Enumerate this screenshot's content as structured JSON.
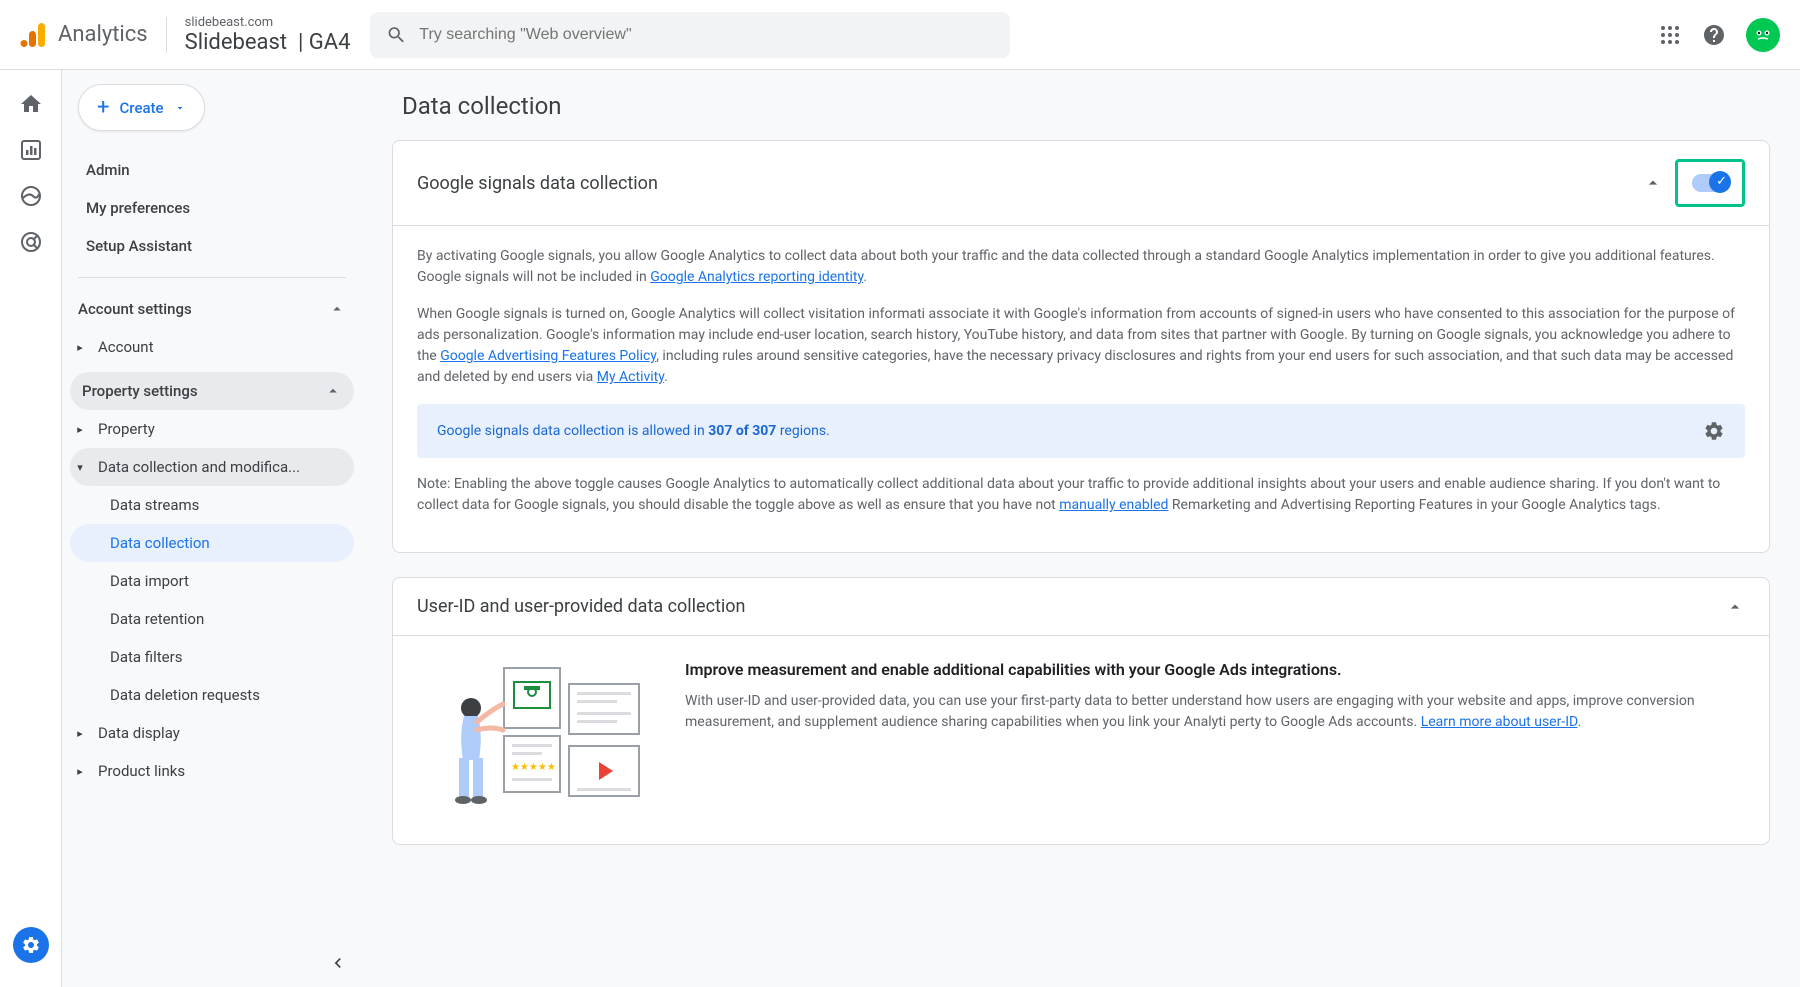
{
  "header": {
    "product_name": "Analytics",
    "domain": "slidebeast.com",
    "property": "Slidebeast",
    "property_suffix": "| GA4",
    "search_placeholder": "Try searching \"Web overview\""
  },
  "sidebar": {
    "create_label": "Create",
    "top_links": [
      "Admin",
      "My preferences",
      "Setup Assistant"
    ],
    "account_settings_label": "Account settings",
    "account_label": "Account",
    "property_settings_label": "Property settings",
    "property_label": "Property",
    "data_collection_group": "Data collection and modifica...",
    "data_items": [
      "Data streams",
      "Data collection",
      "Data import",
      "Data retention",
      "Data filters",
      "Data deletion requests"
    ],
    "data_display_label": "Data display",
    "product_links_label": "Product links"
  },
  "main": {
    "page_title": "Data collection",
    "card1": {
      "title": "Google signals data collection",
      "para1_a": "By activating Google signals, you allow Google Analytics to collect data about both your traffic and the data collected through a standard Google Analytics implementation in order to give you additional features. Google signals will not be included in ",
      "link1": "Google Analytics reporting identity",
      "para2_a": "When Google signals is turned on, Google Analytics will collect visitation informati            associate it with Google's information from accounts of signed-in users who have consented to this association for the purpose of ads personalization. Google's information may include end-user location, search history, YouTube history, and data from sites that partner with Google. By turning on Google signals, you acknowledge you adhere to the ",
      "link2": "Google Advertising Features Policy",
      "para2_b": ", including rules around sensitive categories, have the necessary privacy disclosures and rights from your end users for such association, and that such data may be accessed and deleted by end users via ",
      "link3": "My Activity",
      "banner_pre": "Google signals data collection is allowed in ",
      "banner_bold": "307 of 307",
      "banner_post": " regions.",
      "para3_a": "Note: Enabling the above toggle causes Google Analytics to automatically collect additional data about your traffic to provide additional insights about your users and enable audience sharing. If you don't want to collect data for Google signals, you should disable the toggle above as well as ensure that you have not ",
      "link4": "manually enabled",
      "para3_b": " Remarketing and Advertising Reporting Features in your Google Analytics tags."
    },
    "card2": {
      "title": "User-ID and user-provided data collection",
      "heading": "Improve measurement and enable additional capabilities with your Google Ads integrations.",
      "para_a": "With user-ID and user-provided data, you can use your first-party data to better understand how users are engaging with your website and apps, improve conversion measurement, and supplement audience sharing capabilities when you link your Analyti        perty to Google Ads accounts. ",
      "link": "Learn more about user-ID"
    }
  }
}
